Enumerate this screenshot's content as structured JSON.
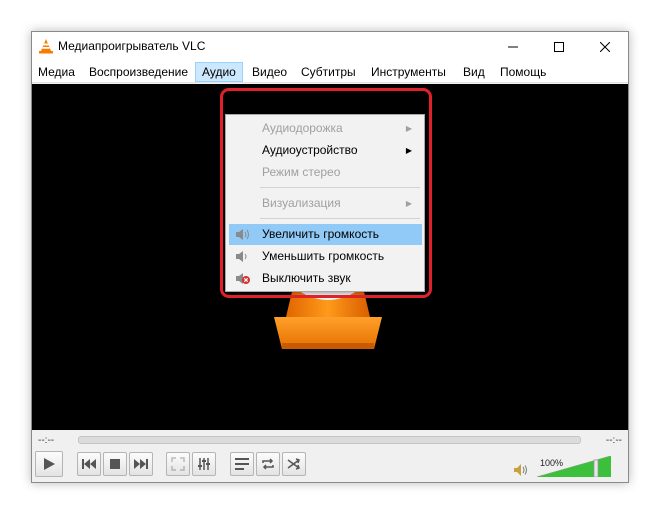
{
  "window": {
    "title": "Медиапроигрыватель VLC",
    "icon": "vlc-cone-icon"
  },
  "menubar": {
    "items": [
      {
        "label": "Медиа"
      },
      {
        "label": "Воспроизведение"
      },
      {
        "label": "Аудио",
        "active": true
      },
      {
        "label": "Видео"
      },
      {
        "label": "Субтитры"
      },
      {
        "label": "Инструменты"
      },
      {
        "label": "Вид"
      },
      {
        "label": "Помощь"
      }
    ]
  },
  "audio_menu": {
    "items": [
      {
        "label": "Аудиодорожка",
        "enabled": false,
        "submenu": true
      },
      {
        "label": "Аудиоустройство",
        "enabled": true,
        "submenu": true
      },
      {
        "label": "Режим стерео",
        "enabled": false,
        "submenu": false
      },
      {
        "label": "Визуализация",
        "enabled": false,
        "submenu": true
      },
      {
        "label": "Увеличить громкость",
        "enabled": true,
        "highlighted": true,
        "icon": "volume-up-icon"
      },
      {
        "label": "Уменьшить громкость",
        "enabled": true,
        "icon": "volume-down-icon"
      },
      {
        "label": "Выключить звук",
        "enabled": true,
        "icon": "mute-icon"
      }
    ],
    "highlight_color": "#91c9f7",
    "annotation_color": "#e0202a"
  },
  "controls": {
    "time_elapsed": "--:--",
    "time_total": "--:--",
    "volume_label": "100%",
    "volume_level": 1.0,
    "buttons": [
      "play-icon",
      "previous-icon",
      "stop-icon",
      "next-icon",
      "fullscreen-icon",
      "extended-settings-icon",
      "playlist-icon",
      "loop-icon",
      "shuffle-icon"
    ]
  },
  "colors": {
    "accent_orange": "#f57c00",
    "volume_green": "#3cc03c",
    "video_bg": "#000000"
  }
}
